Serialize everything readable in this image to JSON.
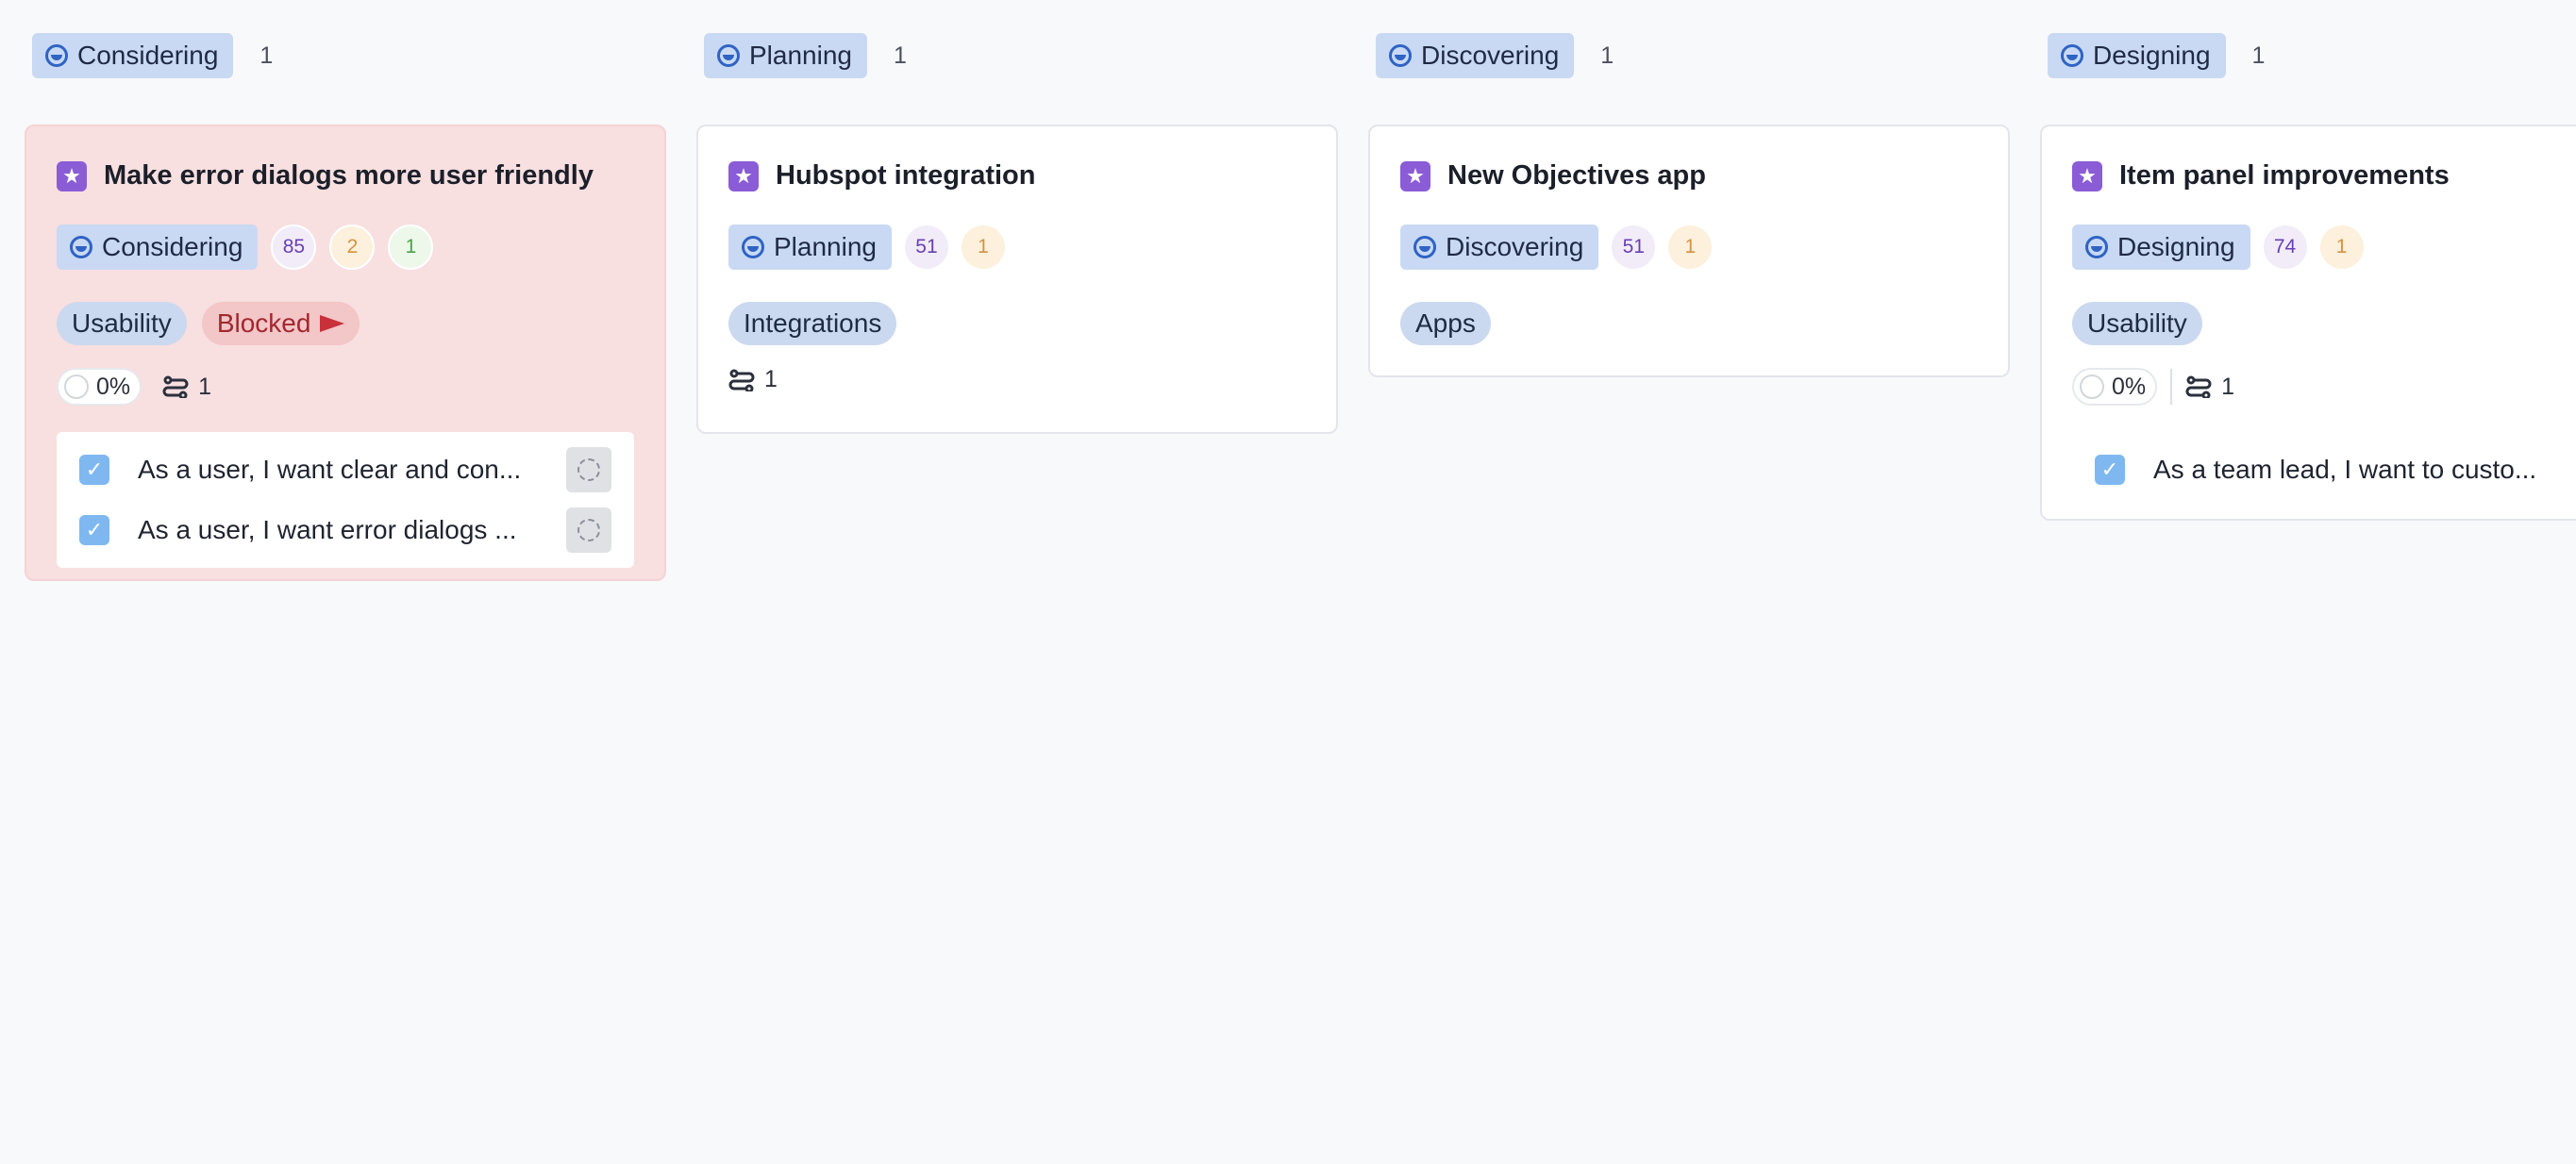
{
  "columns": [
    {
      "status": "Considering",
      "count": "1",
      "card": {
        "title": "Make error dialogs more user friendly",
        "status": "Considering",
        "badges": [
          "85",
          "2",
          "1"
        ],
        "tags": [
          "Usability",
          "Blocked"
        ],
        "progress": "0%",
        "links": "1",
        "stories": [
          "As a user, I want clear and con...",
          "As a user, I want error dialogs ..."
        ]
      }
    },
    {
      "status": "Planning",
      "count": "1",
      "card": {
        "title": "Hubspot integration",
        "status": "Planning",
        "badges": [
          "51",
          "1"
        ],
        "tags": [
          "Integrations"
        ],
        "links": "1"
      }
    },
    {
      "status": "Discovering",
      "count": "1",
      "card": {
        "title": "New Objectives app",
        "status": "Discovering",
        "badges": [
          "51",
          "1"
        ],
        "tags": [
          "Apps"
        ]
      }
    },
    {
      "status": "Designing",
      "count": "1",
      "card": {
        "title": "Item panel improvements",
        "status": "Designing",
        "badges": [
          "74",
          "1"
        ],
        "tags": [
          "Usability"
        ],
        "progress": "0%",
        "links": "1",
        "stories": [
          "As a team lead, I want to custo..."
        ]
      }
    }
  ],
  "colors": {
    "status_bg": "#c9d9f3",
    "status_icon": "#2f63c4",
    "star_bg": "#8a5cd6",
    "blocked_card_bg": "#f8dfe0",
    "blocked_tag_bg": "#f3c6c8",
    "tag_bg": "#cad9ef",
    "checkbox": "#7fb8f0"
  },
  "icons": {
    "status": "status-circle-icon",
    "star": "star-icon",
    "flag": "flag-icon",
    "links": "link-icon",
    "checkbox": "checkbox-icon",
    "loader": "loader-icon"
  }
}
